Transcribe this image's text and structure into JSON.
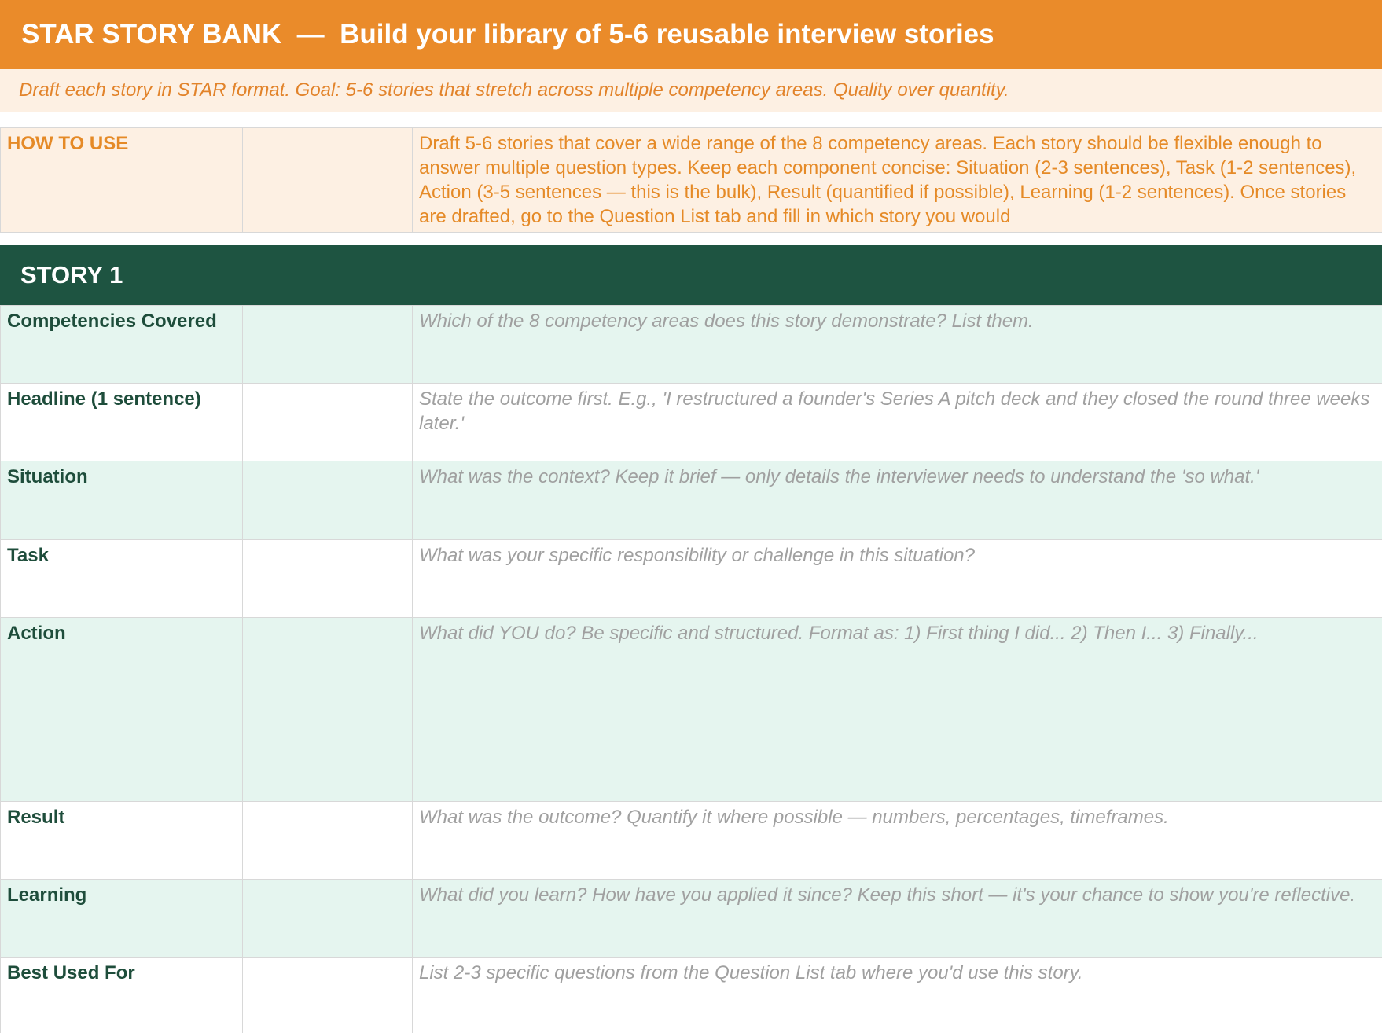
{
  "header": {
    "title": "STAR STORY BANK  —  Build your library of 5-6 reusable interview stories",
    "subtitle": "Draft each story in STAR format. Goal: 5-6 stories that stretch across multiple competency areas. Quality over quantity."
  },
  "how_to_use": {
    "label": "HOW TO USE",
    "text": "Draft 5-6 stories that cover a wide range of the 8 competency areas. Each story should be flexible enough to answer multiple question types. Keep each component concise: Situation (2-3 sentences), Task (1-2 sentences), Action (3-5 sentences — this is the bulk), Result (quantified if possible), Learning (1-2 sentences). Once stories are drafted, go to the Question List tab and fill in which story you would"
  },
  "story": {
    "title": "STORY 1",
    "rows": [
      {
        "field": "Competencies Covered",
        "hint": "Which of the 8 competency areas does this story demonstrate? List them."
      },
      {
        "field": "Headline (1 sentence)",
        "hint": "State the outcome first. E.g., 'I restructured a founder's Series A pitch deck and they closed the round three weeks later.'"
      },
      {
        "field": "Situation",
        "hint": "What was the context? Keep it brief — only details the interviewer needs to understand the 'so what.'"
      },
      {
        "field": "Task",
        "hint": "What was your specific responsibility or challenge in this situation?"
      },
      {
        "field": "Action",
        "hint": "What did YOU do? Be specific and structured. Format as: 1) First thing I did... 2) Then I... 3) Finally..."
      },
      {
        "field": "Result",
        "hint": "What was the outcome? Quantify it where possible — numbers, percentages, timeframes."
      },
      {
        "field": "Learning",
        "hint": "What did you learn? How have you applied it since? Keep this short — it's your chance to show you're reflective."
      },
      {
        "field": "Best Used For",
        "hint": "List 2-3 specific questions from the Question List tab where you'd use this story."
      }
    ]
  }
}
